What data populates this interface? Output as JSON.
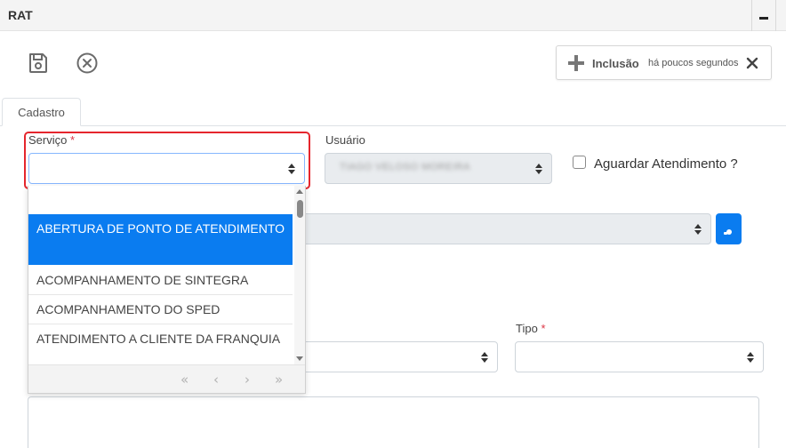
{
  "window": {
    "title": "RAT"
  },
  "notification": {
    "label": "Inclusão",
    "time": "há poucos segundos"
  },
  "tabs": [
    {
      "label": "Cadastro"
    }
  ],
  "form": {
    "servico_label": "Serviço",
    "required_mark": "*",
    "usuario_label": "Usuário",
    "usuario_value": "TIAGO VELOSO MOREIRA",
    "aguardar_label": "Aguardar Atendimento ?",
    "tipo_label": "Tipo"
  },
  "dropdown": {
    "items": [
      {
        "label": "ABERTURA DE PONTO DE ATENDIMENTO"
      },
      {
        "label": "ACOMPANHAMENTO DE SINTEGRA"
      },
      {
        "label": "ACOMPANHAMENTO DO SPED"
      },
      {
        "label": "ATENDIMENTO A CLIENTE DA FRANQUIA"
      }
    ],
    "pager": {
      "first": "«",
      "prev": "‹",
      "next": "›",
      "last": "»"
    }
  },
  "colors": {
    "accent": "#0a7cf0",
    "highlight": "#e5262d",
    "required": "#dc3545"
  }
}
